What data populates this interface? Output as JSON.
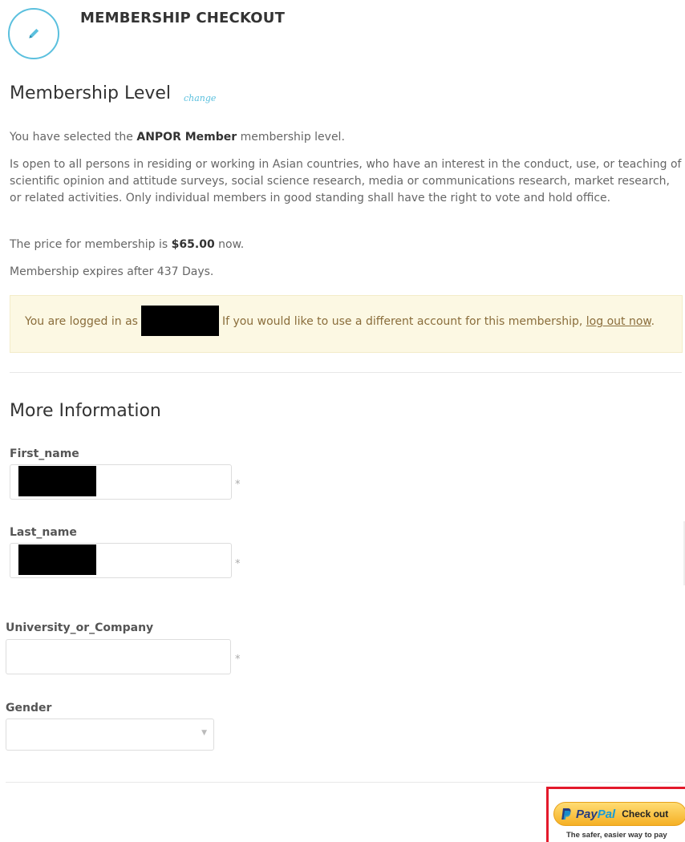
{
  "header": {
    "icon": "pencil-icon",
    "title": "MEMBERSHIP CHECKOUT"
  },
  "membership": {
    "heading": "Membership Level",
    "change_link": "change",
    "selected_prefix": "You have selected the ",
    "level_name": "ANPOR Member",
    "selected_suffix": " membership level.",
    "description": "Is open to all persons in residing or working in Asian countries, who have an interest in the conduct, use, or teaching of scientific opinion and attitude surveys, social science research, media or communications research, market research, or related activities. Only individual members in good standing shall have the right to vote and hold office.",
    "price_prefix": "The price for membership is ",
    "price": "$65.00",
    "price_suffix": " now.",
    "expires": "Membership expires after 437 Days."
  },
  "login_notice": {
    "prefix": "You are logged in as",
    "suffix": "If you would like to use a different account for this membership,",
    "logout_link": "log out now",
    "end": "."
  },
  "more_info": {
    "heading": "More Information",
    "fields": {
      "first_name": {
        "label": "First_name",
        "required": "*"
      },
      "last_name": {
        "label": "Last_name",
        "required": "*"
      },
      "university": {
        "label": "University_or_Company",
        "value": "",
        "required": "*"
      },
      "gender": {
        "label": "Gender",
        "value": ""
      }
    }
  },
  "paypal": {
    "brand_pay": "Pay",
    "brand_pal": "Pal",
    "button_label": "Check out",
    "tagline": "The safer, easier way to pay",
    "highlight_color": "#e3192b"
  },
  "colors": {
    "accent": "#5bc0de",
    "notice_bg": "#fcf8e3"
  }
}
